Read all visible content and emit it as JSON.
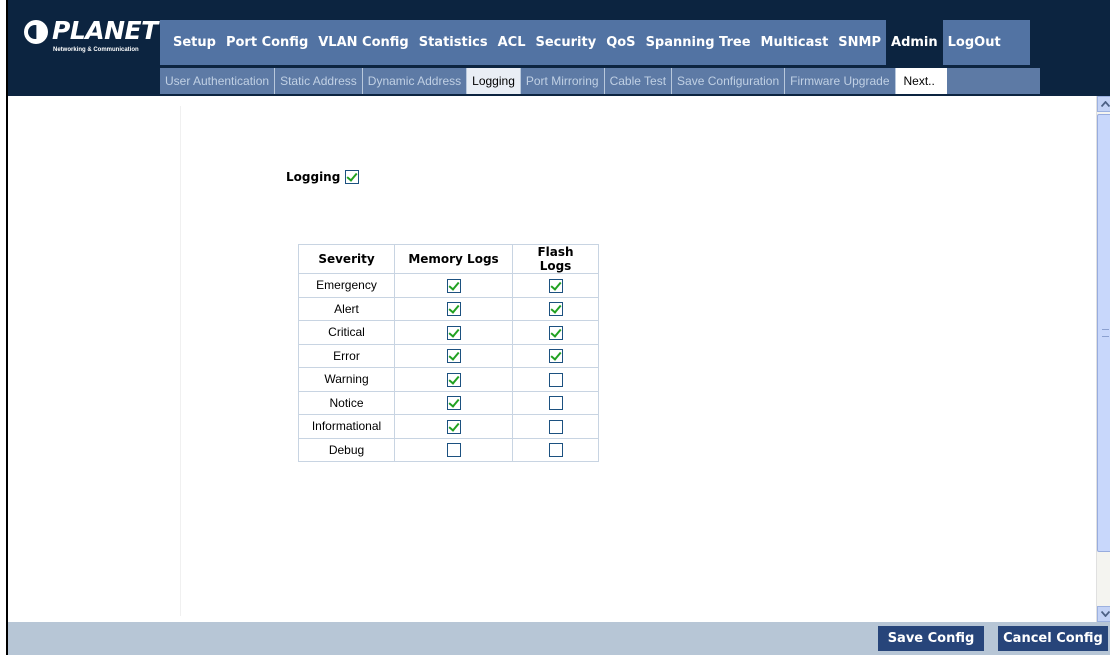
{
  "brand": {
    "name": "PLANET",
    "tagline": "Networking & Communication"
  },
  "main_menu": [
    {
      "label": "Setup",
      "active": false
    },
    {
      "label": "Port Config",
      "active": false
    },
    {
      "label": "VLAN Config",
      "active": false
    },
    {
      "label": "Statistics",
      "active": false
    },
    {
      "label": "ACL",
      "active": false
    },
    {
      "label": "Security",
      "active": false
    },
    {
      "label": "QoS",
      "active": false
    },
    {
      "label": "Spanning Tree",
      "active": false
    },
    {
      "label": "Multicast",
      "active": false
    },
    {
      "label": "SNMP",
      "active": false
    },
    {
      "label": "Admin",
      "active": true
    },
    {
      "label": "LogOut",
      "active": false
    }
  ],
  "sub_menu": [
    {
      "label": "User Authentication",
      "active": false
    },
    {
      "label": "Static Address",
      "active": false
    },
    {
      "label": "Dynamic Address",
      "active": false
    },
    {
      "label": "Logging",
      "active": true
    },
    {
      "label": "Port Mirroring",
      "active": false
    },
    {
      "label": "Cable Test",
      "active": false
    },
    {
      "label": "Save Configuration",
      "active": false
    },
    {
      "label": "Firmware Upgrade",
      "active": false
    },
    {
      "label": "Next..",
      "active": false
    }
  ],
  "logging": {
    "label": "Logging",
    "enabled": true
  },
  "severity_table": {
    "headers": [
      "Severity",
      "Memory Logs",
      "Flash Logs"
    ],
    "rows": [
      {
        "severity": "Emergency",
        "memory": true,
        "flash": true
      },
      {
        "severity": "Alert",
        "memory": true,
        "flash": true
      },
      {
        "severity": "Critical",
        "memory": true,
        "flash": true
      },
      {
        "severity": "Error",
        "memory": true,
        "flash": true
      },
      {
        "severity": "Warning",
        "memory": true,
        "flash": false
      },
      {
        "severity": "Notice",
        "memory": true,
        "flash": false
      },
      {
        "severity": "Informational",
        "memory": true,
        "flash": false
      },
      {
        "severity": "Debug",
        "memory": false,
        "flash": false
      }
    ]
  },
  "footer": {
    "save_label": "Save Config",
    "cancel_label": "Cancel Config"
  },
  "colors": {
    "header_dark": "#0c2440",
    "menu_blue": "#5273a3",
    "footer_bg": "#b7c6d6",
    "button_bg": "#27457a",
    "check_green": "#21a121"
  }
}
